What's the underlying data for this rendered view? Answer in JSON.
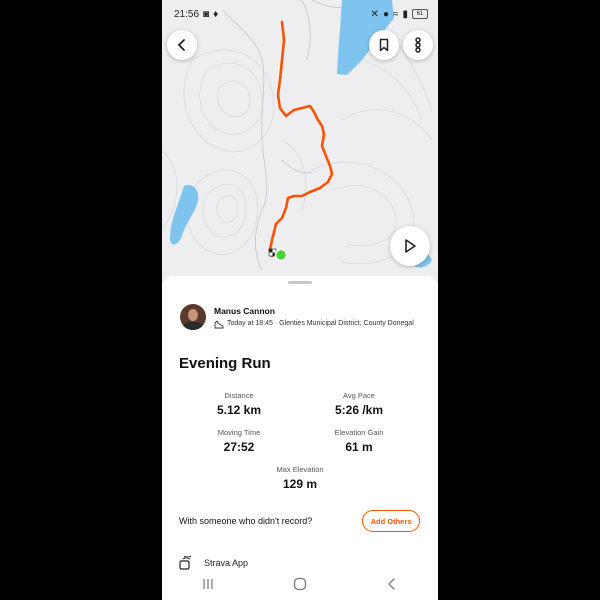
{
  "status_bar": {
    "time": "21:56",
    "battery": "61"
  },
  "map": {
    "route_color": "#fc5200",
    "start_color": "#4cd137",
    "water_color": "#7fc4ef"
  },
  "athlete": {
    "name": "Manus Cannon",
    "activity_meta": "Today at 18:45 · Glenties Municipal District, County Donegal"
  },
  "activity": {
    "title": "Evening Run",
    "stats": [
      {
        "label": "Distance",
        "value": "5.12 km"
      },
      {
        "label": "Avg Pace",
        "value": "5:26 /km"
      },
      {
        "label": "Moving Time",
        "value": "27:52"
      },
      {
        "label": "Elevation Gain",
        "value": "61 m"
      },
      {
        "label": "Max Elevation",
        "value": "129 m"
      }
    ]
  },
  "with_others": {
    "prompt": "With someone who didn't record?",
    "button": "Add Others"
  },
  "device": {
    "label": "Strava App"
  },
  "accent_color": "#fc5200"
}
